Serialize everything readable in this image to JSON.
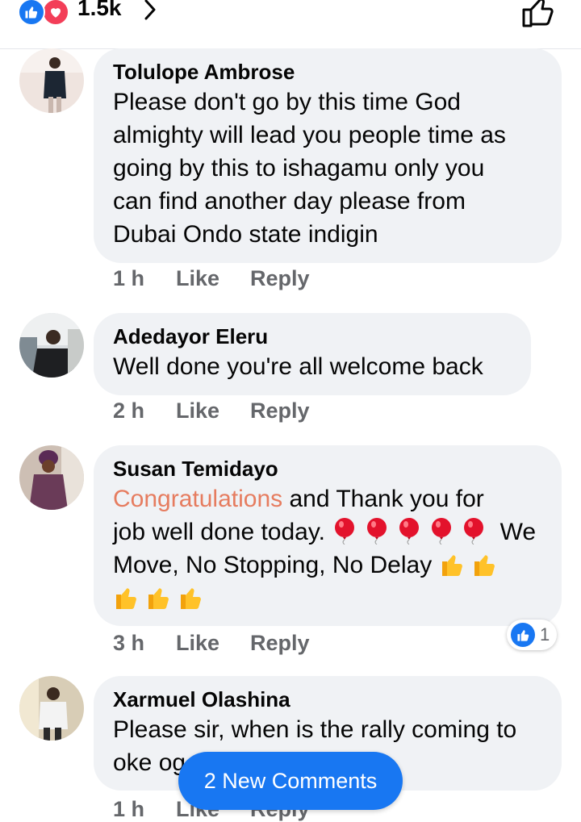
{
  "header": {
    "reaction_count": "1.5k",
    "icons": [
      "like-icon",
      "love-icon",
      "chevron-right-icon",
      "thumbs-up-outline-icon"
    ],
    "colors": {
      "like": "#1877f2",
      "love": "#f33e58"
    }
  },
  "comments": [
    {
      "author": "Tolulope Ambrose",
      "lines": [
        "Please don't go by this time God",
        "almighty will lead you people time as",
        "going by this to ishagamu only you",
        "can find another day please from",
        "Dubai Ondo state indigin"
      ],
      "time": "1 h",
      "like_label": "Like",
      "reply_label": "Reply"
    },
    {
      "author": "Adedayor Eleru",
      "lines": [
        "Well done you're all welcome back"
      ],
      "time": "2 h",
      "like_label": "Like",
      "reply_label": "Reply"
    },
    {
      "author": "Susan Temidayo",
      "highlight": "Congratulations",
      "line1_rest": " and Thank you for",
      "line2": "job well done today. ",
      "line2_after": " We",
      "line3": "Move, No Stopping, No Delay ",
      "emojis": {
        "balloon": "balloon-icon",
        "thumbs": "thumbs-up-emoji-icon"
      },
      "time": "3 h",
      "like_label": "Like",
      "reply_label": "Reply",
      "reaction_badge_count": "1"
    },
    {
      "author": "Xarmuel Olashina",
      "line1": "Please sir, when is the rally coming to",
      "line2": "oke og",
      "time": "1 h",
      "like_label": "Like",
      "reply_label": "Reply"
    }
  ],
  "new_comments_label": "2 New Comments",
  "highlight_color": "#e67c5f"
}
